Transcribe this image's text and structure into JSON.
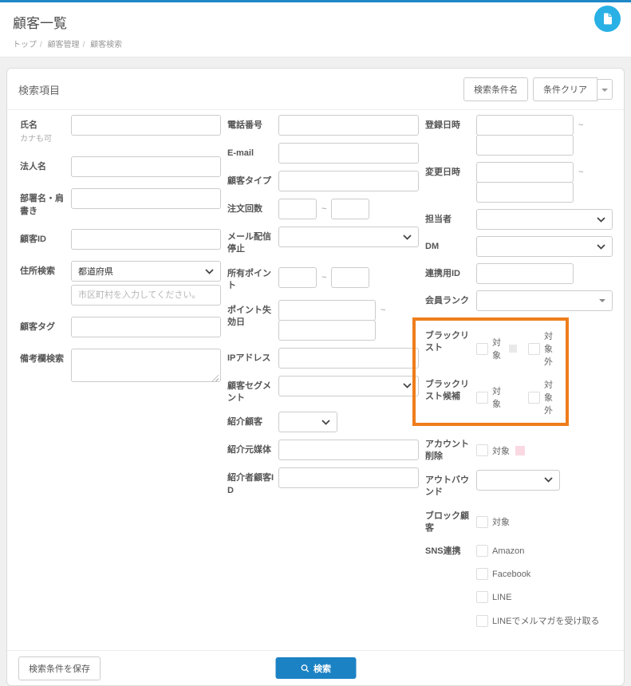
{
  "header": {
    "title": "顧客一覧",
    "breadcrumb": [
      "トップ",
      "顧客管理",
      "顧客検索"
    ],
    "breadcrumb_sep": "/"
  },
  "panel": {
    "title": "検索項目",
    "condition_name_button": "検索条件名",
    "clear_button": "条件クリア"
  },
  "common": {
    "tilde": "~",
    "target": "対象",
    "not_target": "対象外"
  },
  "fields": {
    "name": {
      "label": "氏名",
      "note": "カナも可"
    },
    "corporate_name": {
      "label": "法人名"
    },
    "department": {
      "label": "部署名・肩書き"
    },
    "customer_id": {
      "label": "顧客ID"
    },
    "address": {
      "label": "住所検索",
      "pref_value": "都道府県",
      "city_placeholder": "市区町村を入力してください。"
    },
    "customer_tag": {
      "label": "顧客タグ"
    },
    "notes": {
      "label": "備考欄検索"
    },
    "phone": {
      "label": "電話番号"
    },
    "email": {
      "label": "E-mail"
    },
    "customer_type": {
      "label": "顧客タイプ"
    },
    "order_count": {
      "label": "注文回数"
    },
    "mail_stop": {
      "label": "メール配信停止"
    },
    "points": {
      "label": "所有ポイント"
    },
    "point_expiry": {
      "label": "ポイント失効日"
    },
    "ip_address": {
      "label": "IPアドレス"
    },
    "segment": {
      "label": "顧客セグメント"
    },
    "referral_customer": {
      "label": "紹介顧客"
    },
    "referral_source": {
      "label": "紹介元媒体"
    },
    "referrer_customer_id": {
      "label": "紹介者顧客ID"
    },
    "registered_at": {
      "label": "登録日時"
    },
    "updated_at": {
      "label": "変更日時"
    },
    "staff": {
      "label": "担当者"
    },
    "dm": {
      "label": "DM"
    },
    "link_id": {
      "label": "連携用ID"
    },
    "member_rank": {
      "label": "会員ランク"
    },
    "blacklist": {
      "label": "ブラックリスト"
    },
    "blacklist_candidate": {
      "label": "ブラックリスト候補"
    },
    "account_delete": {
      "label": "アカウント削除"
    },
    "outbound": {
      "label": "アウトバウンド"
    },
    "block_customer": {
      "label": "ブロック顧客"
    },
    "sns": {
      "label": "SNS連携",
      "options": [
        "Amazon",
        "Facebook",
        "LINE",
        "LINEでメルマガを受け取る"
      ]
    }
  },
  "footer": {
    "save_button": "検索条件を保存",
    "search_button": "検索"
  },
  "colors": {
    "topbar": "#1e88c7",
    "fab": "#29b0e4",
    "search_button": "#1b82c4",
    "highlight_border": "#ee7d1c",
    "blacklist_swatch": "#e9e9e9",
    "account_delete_swatch": "#fbd9e3"
  }
}
